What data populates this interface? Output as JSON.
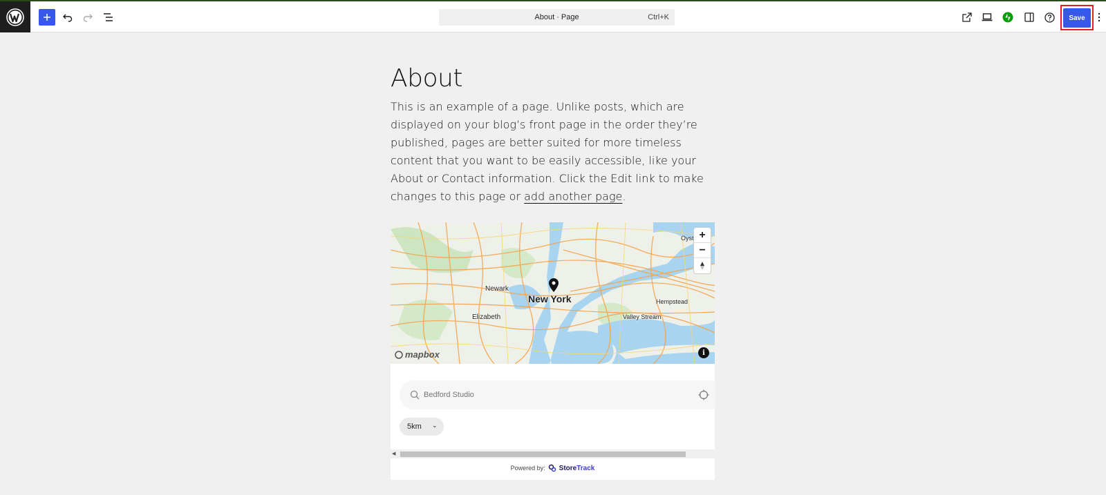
{
  "toolbar": {
    "document_title": "About · Page",
    "shortcut": "Ctrl+K",
    "save_label": "Save"
  },
  "icons": {
    "logo": "wordpress-logo",
    "add": "plus-icon",
    "undo": "undo-icon",
    "redo": "redo-icon",
    "list_view": "list-view-icon",
    "view": "external-link-icon",
    "preview": "laptop-icon",
    "jetpack": "jetpack-icon",
    "settings": "sidebar-icon",
    "help": "help-icon",
    "more": "more-vertical-icon"
  },
  "page": {
    "title": "About",
    "body_text": "This is an example of a page. Unlike posts, which are displayed on your blog’s front page in the order they’re published, pages are better suited for more timeless content that you want to be easily accessible, like your About or Contact information. Click the Edit link to make changes to this page or ",
    "link_text": "add another page",
    "body_end": "."
  },
  "map": {
    "labels": [
      "Newark",
      "New York",
      "Elizabeth",
      "Hempstead",
      "Valley Stream",
      "Oyst"
    ],
    "attribution": "mapbox",
    "zoom_in": "+",
    "zoom_out": "−",
    "info": "i",
    "search_placeholder": "Bedford Studio",
    "radius_value": "5km",
    "powered_by": "Powered by:",
    "brand_a": "Store",
    "brand_b": "Track"
  },
  "colors": {
    "accent": "#3858e9",
    "highlight": "#e11d1d",
    "water": "#a8d4f0",
    "roads": "#f5a34a",
    "parks": "#cde5c1"
  }
}
